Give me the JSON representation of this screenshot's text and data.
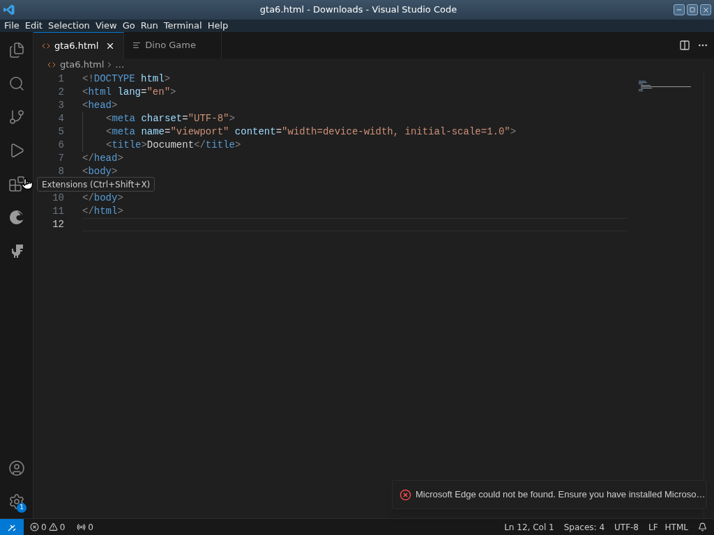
{
  "window": {
    "title": "gta6.html - Downloads - Visual Studio Code"
  },
  "menu": [
    "File",
    "Edit",
    "Selection",
    "View",
    "Go",
    "Run",
    "Terminal",
    "Help"
  ],
  "activity_bar": {
    "settings_badge": "1"
  },
  "tabs": [
    {
      "label": "gta6.html",
      "kind": "html",
      "selected": true
    },
    {
      "label": "Dino Game",
      "kind": "preview",
      "selected": false
    }
  ],
  "breadcrumb": [
    "gta6.html",
    "…"
  ],
  "editor": {
    "lines": [
      {
        "number": "1",
        "current": false,
        "indented": false,
        "tokens": [
          {
            "kind": "punct",
            "text": "<!"
          },
          {
            "kind": "tag",
            "text": "DOCTYPE"
          },
          {
            "kind": "attr",
            "text": " html"
          },
          {
            "kind": "punct",
            "text": ">"
          }
        ]
      },
      {
        "number": "2",
        "current": false,
        "indented": false,
        "tokens": [
          {
            "kind": "punct",
            "text": "<"
          },
          {
            "kind": "tag",
            "text": "html"
          },
          {
            "kind": "attr",
            "text": " lang"
          },
          {
            "kind": "text",
            "text": "="
          },
          {
            "kind": "string",
            "text": "\"en\""
          },
          {
            "kind": "punct",
            "text": ">"
          }
        ]
      },
      {
        "number": "3",
        "current": false,
        "indented": false,
        "tokens": [
          {
            "kind": "punct",
            "text": "<"
          },
          {
            "kind": "tag",
            "text": "head"
          },
          {
            "kind": "punct",
            "text": ">"
          }
        ]
      },
      {
        "number": "4",
        "current": false,
        "indented": true,
        "tokens": [
          {
            "kind": "punct",
            "text": "<"
          },
          {
            "kind": "tag",
            "text": "meta"
          },
          {
            "kind": "attr",
            "text": " charset"
          },
          {
            "kind": "text",
            "text": "="
          },
          {
            "kind": "string",
            "text": "\"UTF-8\""
          },
          {
            "kind": "punct",
            "text": ">"
          }
        ]
      },
      {
        "number": "5",
        "current": false,
        "indented": true,
        "tokens": [
          {
            "kind": "punct",
            "text": "<"
          },
          {
            "kind": "tag",
            "text": "meta"
          },
          {
            "kind": "attr",
            "text": " name"
          },
          {
            "kind": "text",
            "text": "="
          },
          {
            "kind": "string",
            "text": "\"viewport\""
          },
          {
            "kind": "attr",
            "text": " content"
          },
          {
            "kind": "text",
            "text": "="
          },
          {
            "kind": "string",
            "text": "\"width=device-width, initial-scale=1.0\""
          },
          {
            "kind": "punct",
            "text": ">"
          }
        ]
      },
      {
        "number": "6",
        "current": false,
        "indented": true,
        "tokens": [
          {
            "kind": "punct",
            "text": "<"
          },
          {
            "kind": "tag",
            "text": "title"
          },
          {
            "kind": "punct",
            "text": ">"
          },
          {
            "kind": "text",
            "text": "Document"
          },
          {
            "kind": "punct",
            "text": "</"
          },
          {
            "kind": "tag",
            "text": "title"
          },
          {
            "kind": "punct",
            "text": ">"
          }
        ]
      },
      {
        "number": "7",
        "current": false,
        "indented": false,
        "tokens": [
          {
            "kind": "punct",
            "text": "</"
          },
          {
            "kind": "tag",
            "text": "head"
          },
          {
            "kind": "punct",
            "text": ">"
          }
        ]
      },
      {
        "number": "8",
        "current": false,
        "indented": false,
        "tokens": [
          {
            "kind": "punct",
            "text": "<"
          },
          {
            "kind": "tag",
            "text": "body"
          },
          {
            "kind": "punct",
            "text": ">"
          }
        ]
      },
      {
        "current": false,
        "indented": false
      },
      {
        "number": "10",
        "current": false,
        "indented": false,
        "tokens": [
          {
            "kind": "punct",
            "text": "</"
          },
          {
            "kind": "tag",
            "text": "body"
          },
          {
            "kind": "punct",
            "text": ">"
          }
        ]
      },
      {
        "number": "11",
        "current": false,
        "indented": false,
        "tokens": [
          {
            "kind": "punct",
            "text": "</"
          },
          {
            "kind": "tag",
            "text": "html"
          },
          {
            "kind": "punct",
            "text": ">"
          }
        ]
      },
      {
        "number": "12",
        "current": true,
        "indented": false
      }
    ]
  },
  "tooltip": "Extensions (Ctrl+Shift+X)",
  "notification": {
    "message": "Microsoft Edge could not be found. Ensure you have installed Microso…"
  },
  "status_bar": {
    "errors": "0",
    "warnings": "0",
    "ports": "0",
    "position": "Ln 12, Col 1",
    "spaces": "Spaces: 4",
    "encoding": "UTF-8",
    "eol": "LF",
    "language": "HTML"
  }
}
